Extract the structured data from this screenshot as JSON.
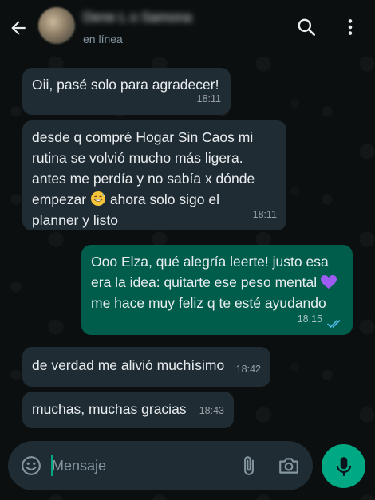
{
  "header": {
    "contact_name": "Dene L o Samona",
    "status": "en línea",
    "icons": [
      "back-arrow-icon",
      "search-icon",
      "more-vert-icon"
    ]
  },
  "messages": [
    {
      "direction": "in",
      "text": "Oii, pasé solo para agradecer!",
      "time": "18:11"
    },
    {
      "direction": "in",
      "text": "desde q compré Hogar Sin Caos mi\nrutina se volvió mucho más ligera.\nantes me perdía y no sabía x dónde\nempezar 😅 ahora solo sigo el\nplanner y listo",
      "time": "18:11"
    },
    {
      "direction": "out",
      "text": "Ooo Elza, qué alegría leerte! justo esa\nera la idea: quitarte ese peso mental 💜\nme hace muy feliz q te esté ayudando",
      "time": "18:15",
      "status": "read"
    },
    {
      "direction": "in",
      "text": "de verdad me alivió muchísimo",
      "time": "18:42"
    },
    {
      "direction": "in",
      "text": "muchas, muchas gracias",
      "time": "18:43"
    }
  ],
  "composer": {
    "placeholder": "Mensaje",
    "icons": [
      "emoji-icon",
      "attach-icon",
      "camera-icon",
      "mic-icon"
    ]
  },
  "colors": {
    "background": "#0b0f10",
    "incoming_bubble": "#202c33",
    "outgoing_bubble": "#005c4b",
    "accent": "#00a884",
    "read_ticks": "#53bdeb"
  }
}
